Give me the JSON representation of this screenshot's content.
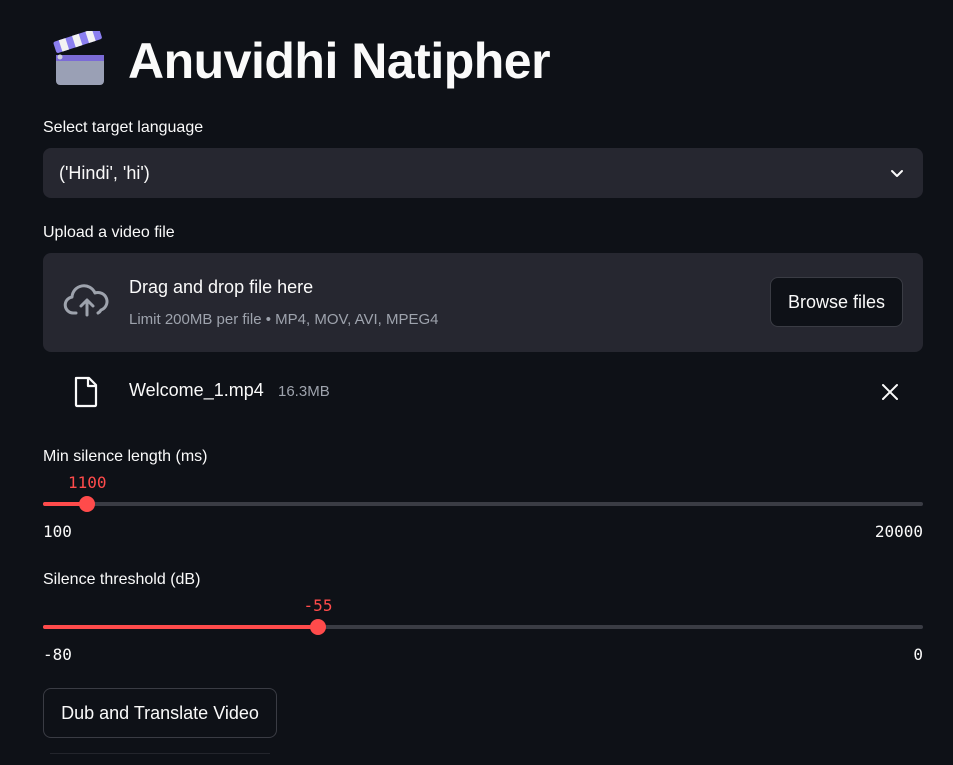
{
  "app": {
    "title": "Anuvidhi Natipher",
    "title_icon": "clapperboard-icon"
  },
  "language_select": {
    "label": "Select target language",
    "value": "('Hindi', 'hi')",
    "icon": "chevron-down-icon"
  },
  "uploader": {
    "label": "Upload a video file",
    "drop_title": "Drag and drop file here",
    "drop_subtitle": "Limit 200MB per file • MP4, MOV, AVI, MPEG4",
    "browse_label": "Browse files",
    "icon": "cloud-upload-icon"
  },
  "uploaded_file": {
    "name": "Welcome_1.mp4",
    "size": "16.3MB",
    "icon": "file-icon",
    "remove_icon": "close-icon"
  },
  "silence_length_slider": {
    "label": "Min silence length (ms)",
    "value": 1100,
    "value_text": "1100",
    "min": 100,
    "max": 20000,
    "min_text": "100",
    "max_text": "20000"
  },
  "silence_threshold_slider": {
    "label": "Silence threshold (dB)",
    "value": -55,
    "value_text": "-55",
    "min": -80,
    "max": 0,
    "min_text": "-80",
    "max_text": "0"
  },
  "action": {
    "button_label": "Dub and Translate Video"
  },
  "colors": {
    "background": "#0e1117",
    "surface": "#262730",
    "accent": "#ff4b4b",
    "text": "#fafafa",
    "muted_text": "#9ea3ad"
  }
}
